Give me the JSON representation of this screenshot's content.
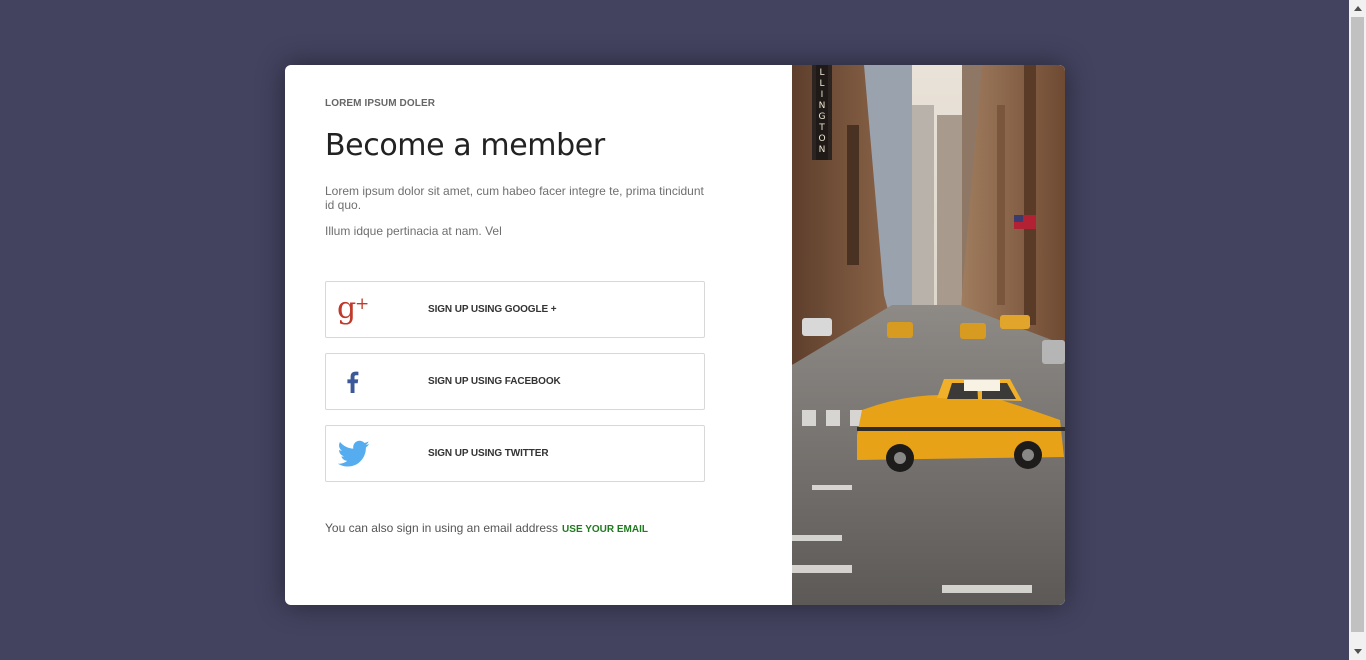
{
  "colors": {
    "page_background": "#434360",
    "card_background": "#ffffff",
    "link_green": "#1f7a1f",
    "google_red": "#c0392b",
    "facebook_blue": "#3b5998",
    "twitter_blue": "#55acee"
  },
  "signup": {
    "eyebrow": "LOREM IPSUM DOLER",
    "title": "Become a member",
    "description": "Lorem ipsum dolor sit amet, cum habeo facer integre te, prima tincidunt id quo.",
    "description2": "Illum idque pertinacia at nam. Vel"
  },
  "buttons": [
    {
      "label": "SIGN UP USING GOOGLE +",
      "icon": "google-plus-icon"
    },
    {
      "label": "SIGN UP USING FACEBOOK",
      "icon": "facebook-icon"
    },
    {
      "label": "SIGN UP USING TWITTER",
      "icon": "twitter-icon"
    }
  ],
  "footer": {
    "note": "You can also sign in using an email address",
    "link": "USE YOUR EMAIL"
  },
  "photo": {
    "subject": "city-street-taxi-photo",
    "sign_text": "LLINGTON"
  }
}
